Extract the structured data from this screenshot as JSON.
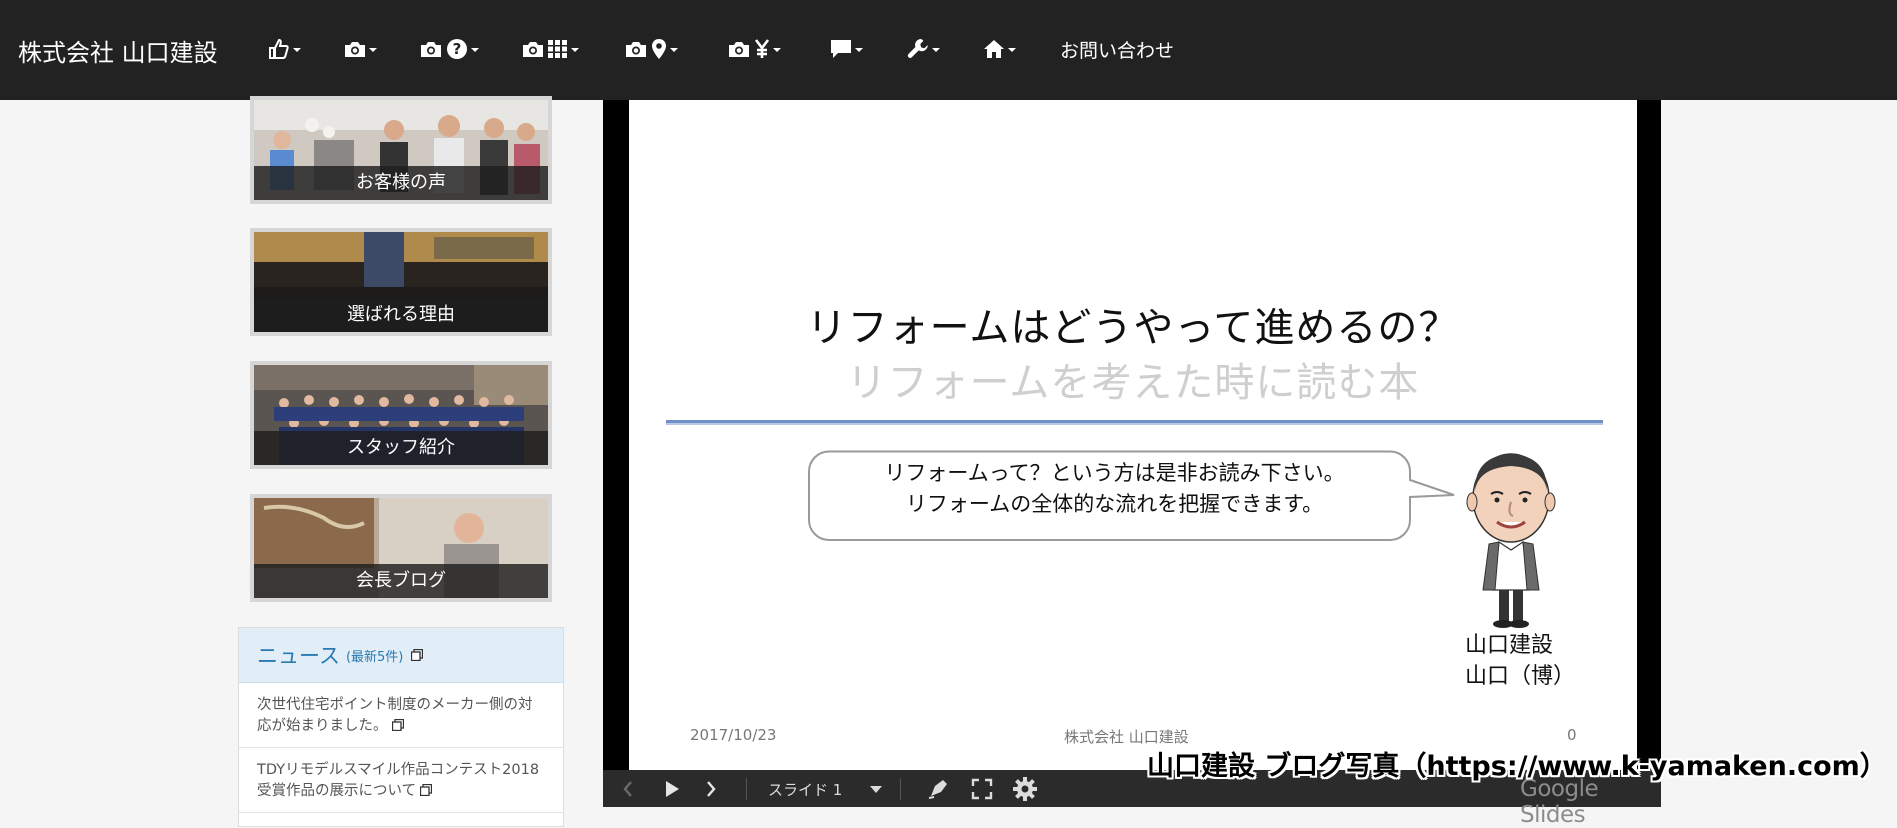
{
  "navbar": {
    "brand": "株式会社 山口建設",
    "items": [
      {
        "icons": [
          "thumbs-up-icon"
        ]
      },
      {
        "icons": [
          "camera-icon"
        ]
      },
      {
        "icons": [
          "camera-icon",
          "question-icon"
        ]
      },
      {
        "icons": [
          "camera-icon",
          "grid-icon"
        ]
      },
      {
        "icons": [
          "camera-icon",
          "map-marker-icon"
        ]
      },
      {
        "icons": [
          "camera-icon",
          "yen-icon"
        ]
      },
      {
        "icons": [
          "comment-icon"
        ]
      },
      {
        "icons": [
          "wrench-icon"
        ]
      },
      {
        "icons": [
          "home-icon"
        ]
      }
    ],
    "contact_label": "お問い合わせ"
  },
  "sidebar": {
    "banners": [
      {
        "label": "お客様の声"
      },
      {
        "label": "選ばれる理由"
      },
      {
        "label": "スタッフ紹介"
      },
      {
        "label": "会長ブログ"
      }
    ],
    "news": {
      "title": "ニュース",
      "subtitle": "(最新5件)",
      "items": [
        "次世代住宅ポイント制度のメーカー側の対応が始まりました。",
        "TDYリモデルスマイル作品コンテスト2018受賞作品の展示について"
      ]
    }
  },
  "slide": {
    "title": "リフォームはどうやって進めるの？",
    "subtitle": "リフォームを考えた時に読む本",
    "bubble_line1": "リフォームって？という方は是非お読み下さい。",
    "bubble_line2": "リフォームの全体的な流れを把握できます。",
    "name_line1": "山口建設",
    "name_line2": "山口（博）",
    "footer_date": "2017/10/23",
    "footer_company": "株式会社 山口建設",
    "footer_page": "0"
  },
  "controls": {
    "slide_label": "スライド 1",
    "brand": "Google Slides"
  },
  "watermark": "山口建設 ブログ写真（https://www.k-yamaken.com）",
  "colors": {
    "navbar_bg": "#222222",
    "news_header_bg": "#e1edf7",
    "news_title": "#2a7ab0",
    "slide_rule": "#6f8fc6"
  }
}
